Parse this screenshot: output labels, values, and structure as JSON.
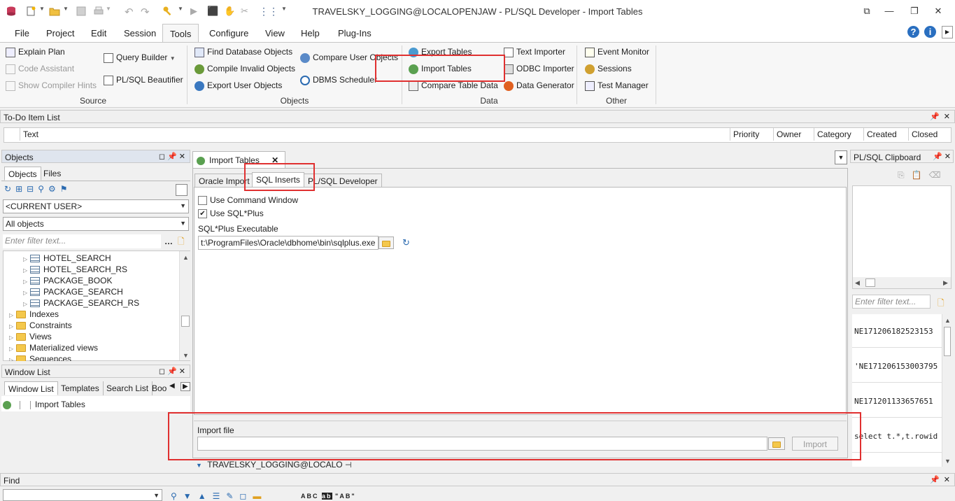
{
  "window": {
    "title": "TRAVELSKY_LOGGING@LOCALOPENJAW - PL/SQL Developer - Import Tables"
  },
  "menu": {
    "items": [
      "File",
      "Project",
      "Edit",
      "Session",
      "Tools",
      "Configure",
      "View",
      "Help",
      "Plug-Ins"
    ],
    "active": "Tools"
  },
  "ribbon": {
    "source": {
      "label": "Source",
      "explain_plan": "Explain Plan",
      "code_assistant": "Code Assistant",
      "show_compiler_hints": "Show Compiler Hints",
      "query_builder": "Query Builder",
      "plsql_beautifier": "PL/SQL Beautifier"
    },
    "objects": {
      "label": "Objects",
      "find_database_objects": "Find Database Objects",
      "compile_invalid_objects": "Compile Invalid Objects",
      "export_user_objects": "Export User Objects",
      "compare_user_objects": "Compare User Objects",
      "dbms_scheduler": "DBMS Scheduler"
    },
    "data": {
      "label": "Data",
      "export_tables": "Export Tables",
      "import_tables": "Import Tables",
      "compare_table_data": "Compare Table Data",
      "text_importer": "Text Importer",
      "odbc_importer": "ODBC Importer",
      "data_generator": "Data Generator"
    },
    "other": {
      "label": "Other",
      "event_monitor": "Event Monitor",
      "sessions": "Sessions",
      "test_manager": "Test Manager"
    }
  },
  "todo": {
    "title": "To-Do Item List",
    "columns": [
      "Text",
      "Priority",
      "Owner",
      "Category",
      "Created",
      "Closed"
    ]
  },
  "objects_pane": {
    "title": "Objects",
    "tabs": [
      "Objects",
      "Files"
    ],
    "user_combo": "<CURRENT USER>",
    "filter_combo": "All objects",
    "filter_placeholder": "Enter filter text...",
    "tables": [
      "HOTEL_SEARCH",
      "HOTEL_SEARCH_RS",
      "PACKAGE_BOOK",
      "PACKAGE_SEARCH",
      "PACKAGE_SEARCH_RS"
    ],
    "folders": [
      "Indexes",
      "Constraints",
      "Views",
      "Materialized views",
      "Sequences"
    ]
  },
  "window_list": {
    "title": "Window List",
    "tabs": [
      "Window List",
      "Templates",
      "Search List",
      "Boo"
    ],
    "items": [
      "Import Tables"
    ]
  },
  "import_window": {
    "tab_title": "Import Tables",
    "tabs": [
      "Oracle Import",
      "SQL Inserts",
      "PL/SQL Developer"
    ],
    "active_tab": "SQL Inserts",
    "use_command_window": "Use Command Window",
    "use_command_window_checked": false,
    "use_sqlplus": "Use SQL*Plus",
    "use_sqlplus_checked": true,
    "sqlplus_label": "SQL*Plus Executable",
    "sqlplus_path": "t:\\ProgramFiles\\Oracle\\dbhome\\bin\\sqlplus.exe",
    "import_file_label": "Import file",
    "import_file_value": "",
    "import_button": "Import",
    "connection": "TRAVELSKY_LOGGING@LOCALO"
  },
  "clipboard": {
    "title": "PL/SQL Clipboard",
    "filter_placeholder": "Enter filter text...",
    "entries": [
      "NE171206182523153",
      "'NE171206153003795",
      "NE171201133657651",
      "select t.*,t.rowid"
    ]
  },
  "find": {
    "title": "Find",
    "value": ""
  }
}
